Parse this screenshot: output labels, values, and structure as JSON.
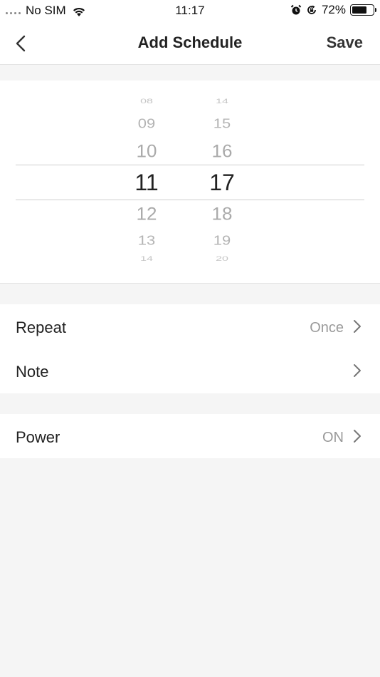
{
  "status_bar": {
    "carrier": "No SIM",
    "time": "11:17",
    "battery_percent": "72%",
    "battery_level": 0.72,
    "icons": [
      "signal-dots-icon",
      "wifi-icon",
      "alarm-icon",
      "rotation-lock-icon",
      "battery-icon"
    ]
  },
  "nav": {
    "title": "Add Schedule",
    "save_label": "Save",
    "back_icon": "chevron-left-icon"
  },
  "picker": {
    "hours": [
      "08",
      "09",
      "10",
      "11",
      "12",
      "13",
      "14"
    ],
    "minutes": [
      "14",
      "15",
      "16",
      "17",
      "18",
      "19",
      "20"
    ],
    "selected_hour": "11",
    "selected_minute": "17"
  },
  "settings": {
    "repeat": {
      "label": "Repeat",
      "value": "Once"
    },
    "note": {
      "label": "Note",
      "value": ""
    },
    "power": {
      "label": "Power",
      "value": "ON"
    }
  },
  "colors": {
    "background": "#f5f5f5",
    "panel": "#ffffff",
    "text_primary": "#222222",
    "text_secondary": "#9a9a9a",
    "picker_faded": "#b4b4b4",
    "divider": "#cfcfcf"
  }
}
